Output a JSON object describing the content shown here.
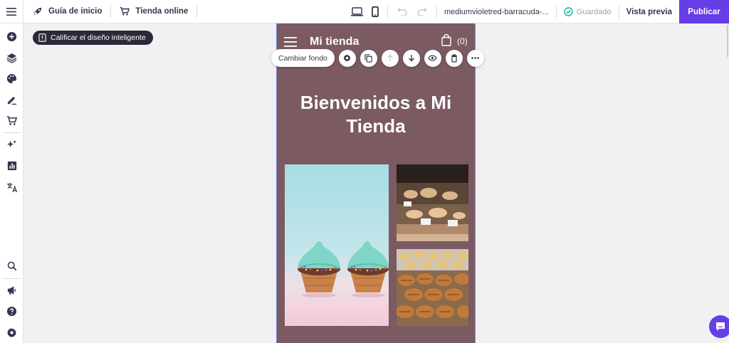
{
  "topbar": {
    "home_guide": "Guía de inicio",
    "online_store": "Tienda online",
    "site_name": "mediumvioletred-barracuda-...",
    "saved_status": "Guardado",
    "preview": "Vista previa",
    "publish": "Publicar"
  },
  "editor": {
    "rate_design": "Calificar el diseño inteligente",
    "change_background": "Cambiar fondo"
  },
  "site": {
    "logo": "Mi tienda",
    "cart_count": "(0)",
    "hero_title": "Bienvenidos a Mi Tienda"
  },
  "colors": {
    "accent": "#673de6",
    "site_bg": "#7b5a61"
  },
  "sidebar_icons": [
    "add-icon",
    "layers-icon",
    "palette-icon",
    "edit-pen-icon",
    "cart-icon",
    "ai-sparkle-icon",
    "analytics-icon",
    "translate-icon",
    "search-icon",
    "megaphone-icon",
    "help-icon",
    "settings-icon"
  ]
}
